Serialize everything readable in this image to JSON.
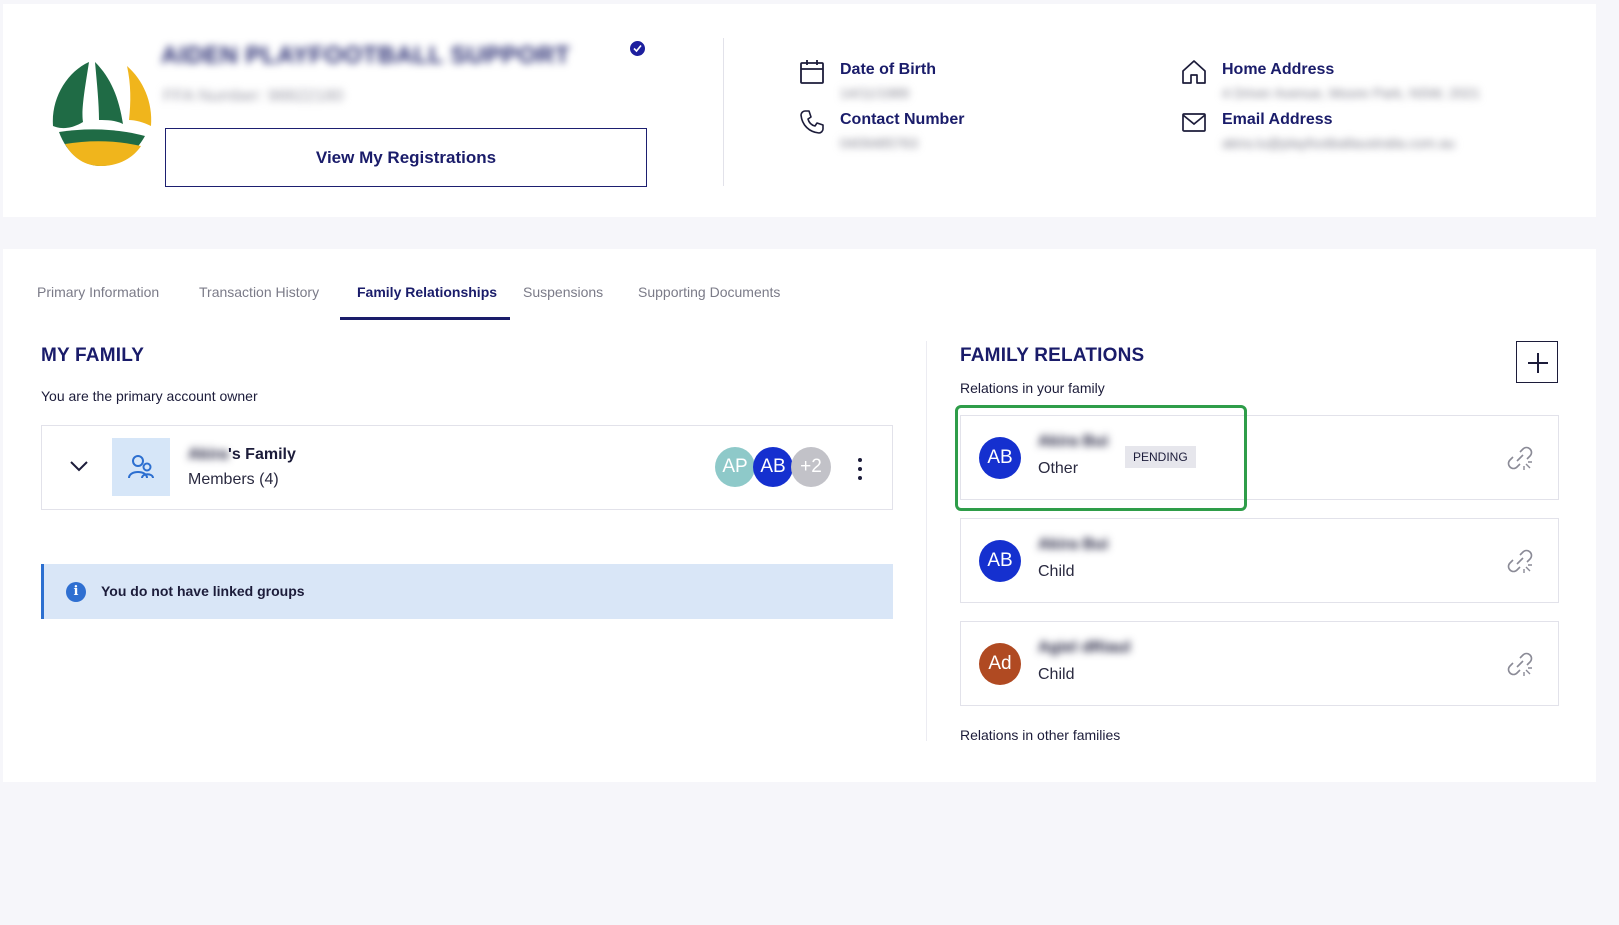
{
  "profile": {
    "name": "AIDEN PLAYFOOTBALL SUPPORT",
    "member_number": "FFA Number: 98822180",
    "view_registrations_label": "View My Registrations",
    "date_of_birth_label": "Date of Birth",
    "date_of_birth_value": "14/11/1989",
    "contact_number_label": "Contact Number",
    "contact_number_value": "0409485763",
    "home_address_label": "Home Address",
    "home_address_value": "4 Driver Avenue, Moore Park, NSW, 2021",
    "email_address_label": "Email Address",
    "email_address_value": "akira.lu@playfootballaustralia.com.au"
  },
  "tabs": [
    {
      "label": "Primary Information",
      "active": false
    },
    {
      "label": "Transaction History",
      "active": false
    },
    {
      "label": "Family Relationships",
      "active": true
    },
    {
      "label": "Suspensions",
      "active": false
    },
    {
      "label": "Supporting Documents",
      "active": false
    }
  ],
  "my_family": {
    "title": "MY FAMILY",
    "subtitle": "You are the primary account owner",
    "family_owner": "Akira",
    "family_suffix": "'s Family",
    "members_label": "Members (4)",
    "avatars": [
      {
        "initials": "AP",
        "color": "#8ec9c9"
      },
      {
        "initials": "AB",
        "color": "#1530cf"
      },
      {
        "initials": "+2",
        "color": "#c2c2c8"
      }
    ],
    "linked_groups_message": "You do not have linked groups"
  },
  "family_relations": {
    "title": "FAMILY RELATIONS",
    "subtitle": "Relations in your family",
    "other_families_label": "Relations in other families",
    "relations": [
      {
        "initials": "AB",
        "name": "Akira Bui",
        "role": "Other",
        "badge": "PENDING",
        "color": "#1530cf"
      },
      {
        "initials": "AB",
        "name": "Akira Bui",
        "role": "Child",
        "badge": "",
        "color": "#1530cf"
      },
      {
        "initials": "Ad",
        "name": "Agiel dRiaul",
        "role": "Child",
        "badge": "",
        "color": "#b04a22"
      }
    ]
  },
  "colors": {
    "brand_navy": "#1a1c6a",
    "highlight_green": "#2e9d49",
    "info_banner_bg": "#d9e6f7"
  }
}
